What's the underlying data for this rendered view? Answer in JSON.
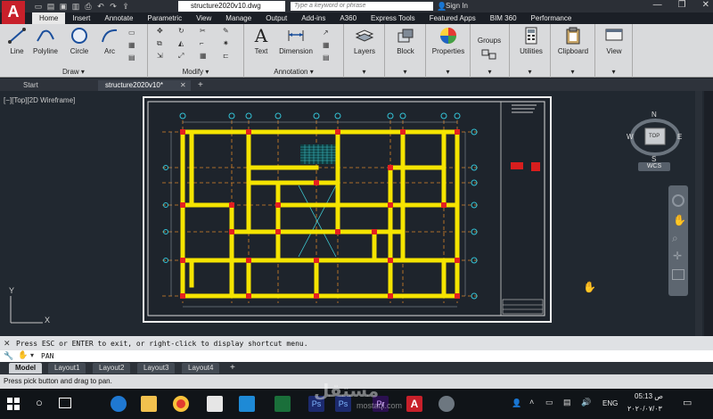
{
  "app": {
    "logo": "A",
    "doc_title": "structure2020v10.dwg",
    "search_placeholder": "Type a keyword or phrase",
    "sign_in": "Sign In"
  },
  "ribbon_tabs": [
    "Home",
    "Insert",
    "Annotate",
    "Parametric",
    "View",
    "Manage",
    "Output",
    "Add-ins",
    "A360",
    "Express Tools",
    "Featured Apps",
    "BIM 360",
    "Performance"
  ],
  "ribbon": {
    "draw": {
      "title": "Draw",
      "buttons": [
        "Line",
        "Polyline",
        "Circle",
        "Arc"
      ]
    },
    "modify": {
      "title": "Modify"
    },
    "annotation": {
      "title": "Annotation",
      "buttons": [
        "Text",
        "Dimension"
      ]
    },
    "big_buttons": [
      "Layers",
      "Block",
      "Properties",
      "Groups",
      "Utilities",
      "Clipboard",
      "View"
    ]
  },
  "file_tabs": [
    "Start",
    "structure2020v10*"
  ],
  "viewport": {
    "label": "[−][Top][2D Wireframe]",
    "viewcube": {
      "n": "N",
      "s": "S",
      "e": "E",
      "w": "W",
      "top": "TOP",
      "wcs": "WCS"
    },
    "ucs_x": "X",
    "ucs_y": "Y"
  },
  "command": {
    "history": "Press ESC or ENTER to exit, or right-click to display shortcut menu.",
    "current": "PAN"
  },
  "layout_tabs": [
    "Model",
    "Layout1",
    "Layout2",
    "Layout3",
    "Layout4"
  ],
  "status_text": "Press pick button and drag to pan.",
  "taskbar": {
    "lang": "ENG",
    "time": "05:13 ص",
    "date": "٢٠٢٠/٠٧/٠٣",
    "watermark": "مستقل",
    "watermark_url": "mostaql.com"
  },
  "colors": {
    "beam": "#f5e400",
    "column": "#e32020",
    "grid_line": "#d7822a",
    "bubble": "#34c3d6",
    "bracing": "#3ec9d1"
  }
}
